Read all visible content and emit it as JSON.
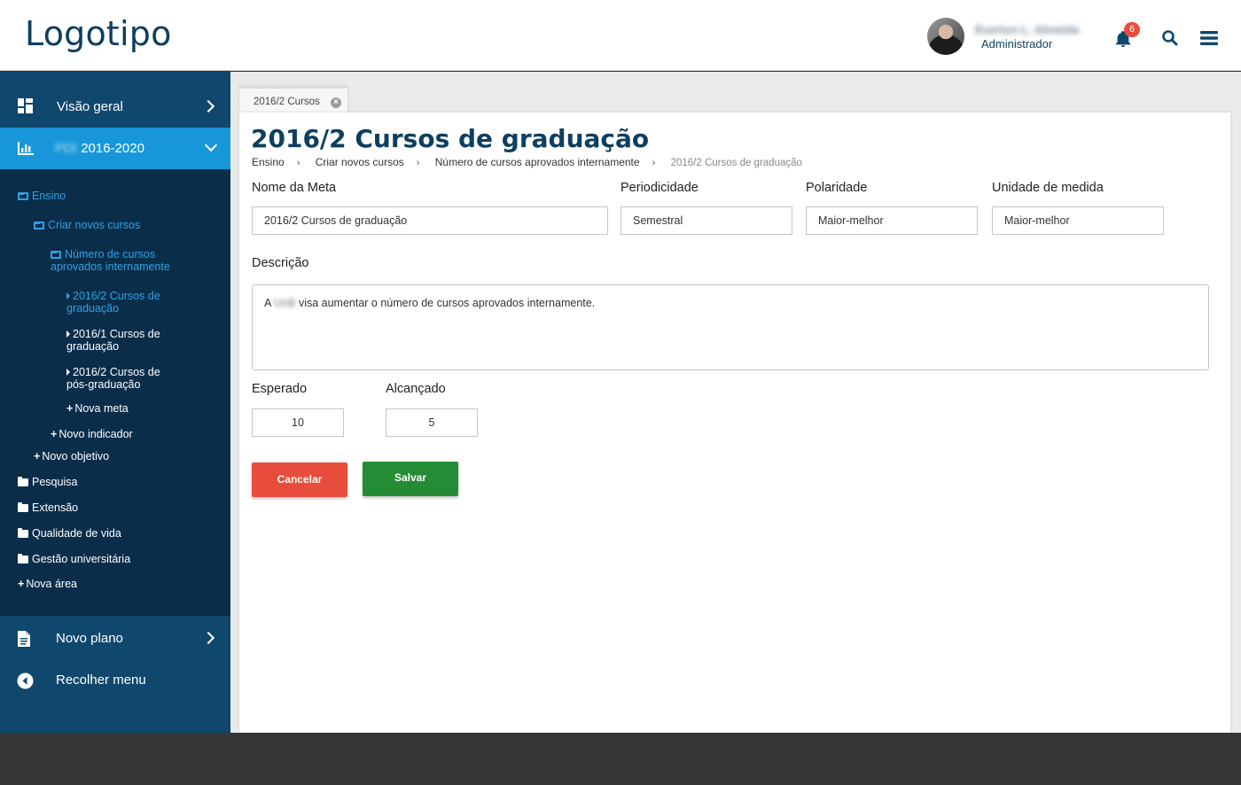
{
  "header": {
    "logo": "Logotipo",
    "user_name": "Everton L. Almeida",
    "user_role": "Administrador",
    "notification_count": "6"
  },
  "sidebar": {
    "overview": "Visão geral",
    "plan_label_hidden": "PDI",
    "plan_period": "2016-2020",
    "tree": {
      "ensino": "Ensino",
      "criar": "Criar novos cursos",
      "numero": "Número de cursos aprovados internamente",
      "meta1": "2016/2 Cursos de graduação",
      "meta2": "2016/1 Cursos de graduação",
      "meta3": "2016/2 Cursos de pós-graduação",
      "nova_meta": "Nova meta",
      "novo_indicador": "Novo indicador",
      "novo_objetivo": "Novo objetivo",
      "pesquisa": "Pesquisa",
      "extensao": "Extensão",
      "qualidade": "Qualidade de vida",
      "gestao": "Gestão universitária",
      "nova_area": "Nova área"
    },
    "new_plan": "Novo plano",
    "collapse": "Recolher menu"
  },
  "tab": {
    "label": "2016/2 Cursos"
  },
  "page": {
    "title": "2016/2 Cursos de graduação",
    "breadcrumb": [
      "Ensino",
      "Criar novos cursos",
      "Número de cursos aprovados internamente",
      "2016/2 Cursos de graduação"
    ]
  },
  "form": {
    "nome_label": "Nome da Meta",
    "nome_value": "2016/2 Cursos de graduação",
    "periodicidade_label": "Periodicidade",
    "periodicidade_value": "Semestral",
    "polaridade_label": "Polaridade",
    "polaridade_value": "Maior-melhor",
    "unidade_label": "Unidade de medida",
    "unidade_value": "Maior-melhor",
    "descricao_label": "Descrição",
    "descricao_prefix": "A",
    "descricao_hidden": "UnB",
    "descricao_text": "visa aumentar o número de cursos aprovados internamente.",
    "esperado_label": "Esperado",
    "esperado_value": "10",
    "alcancado_label": "Alcançado",
    "alcancado_value": "5",
    "cancel_label": "Cancelar",
    "save_label": "Salvar"
  },
  "colors": {
    "brand_dark": "#0d3f5e",
    "sidebar": "#10476d",
    "sidebar_tree": "#0a2d4a",
    "sidebar_active": "#1797d9",
    "danger": "#e74c3c",
    "success": "#238c35"
  }
}
